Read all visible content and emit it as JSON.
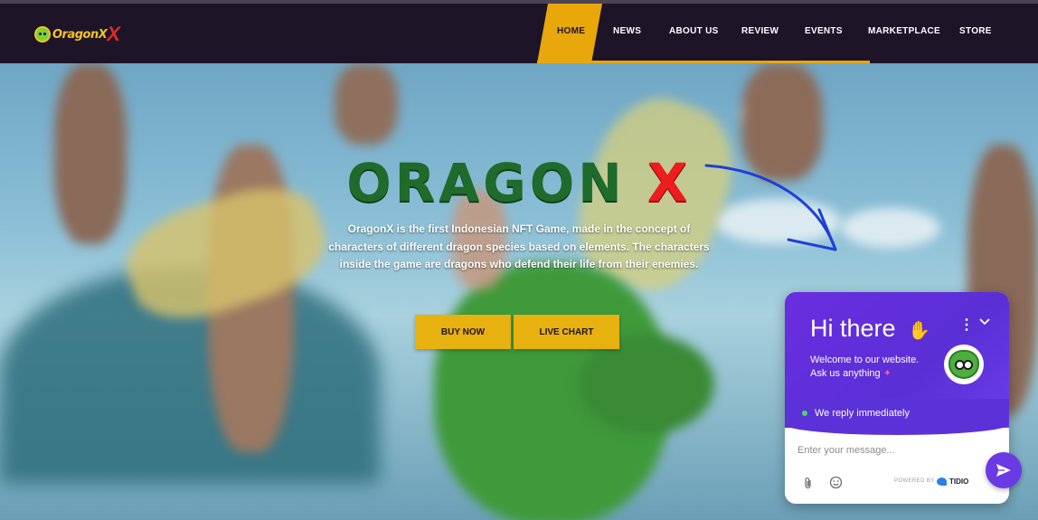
{
  "brand": {
    "logo_text": "OragonX",
    "logo_icon": "dragon-badge-icon"
  },
  "nav": {
    "items": [
      {
        "label": "HOME",
        "active": true
      },
      {
        "label": "NEWS"
      },
      {
        "label": "ABOUT US"
      },
      {
        "label": "REVIEW"
      },
      {
        "label": "EVENTS"
      },
      {
        "label": "MARKETPLACE"
      },
      {
        "label": "STORE"
      }
    ]
  },
  "hero": {
    "title_main": "ORAGON",
    "title_accent": "X",
    "description": "OragonX is the first Indonesian NFT Game, made in the concept of characters of different dragon species based on elements. The characters inside the game are dragons who defend their life from their enemies.",
    "buttons": {
      "buy_now": "BUY NOW",
      "live_chart": "LIVE CHART"
    }
  },
  "chat": {
    "greeting": "Hi there",
    "welcome_line1": "Welcome to our website.",
    "welcome_line2": "Ask us anything",
    "status": "We reply immediately",
    "input_placeholder": "Enter your message...",
    "powered_by": "POWERED BY",
    "provider": "TIDIO"
  },
  "colors": {
    "nav_bg": "#1d1428",
    "accent_gold": "#e8a70a",
    "chat_purple": "#6a2ee0",
    "title_green": "#1f6b2b",
    "title_red": "#ee1c1c",
    "arrow_blue": "#1f3fd6"
  }
}
